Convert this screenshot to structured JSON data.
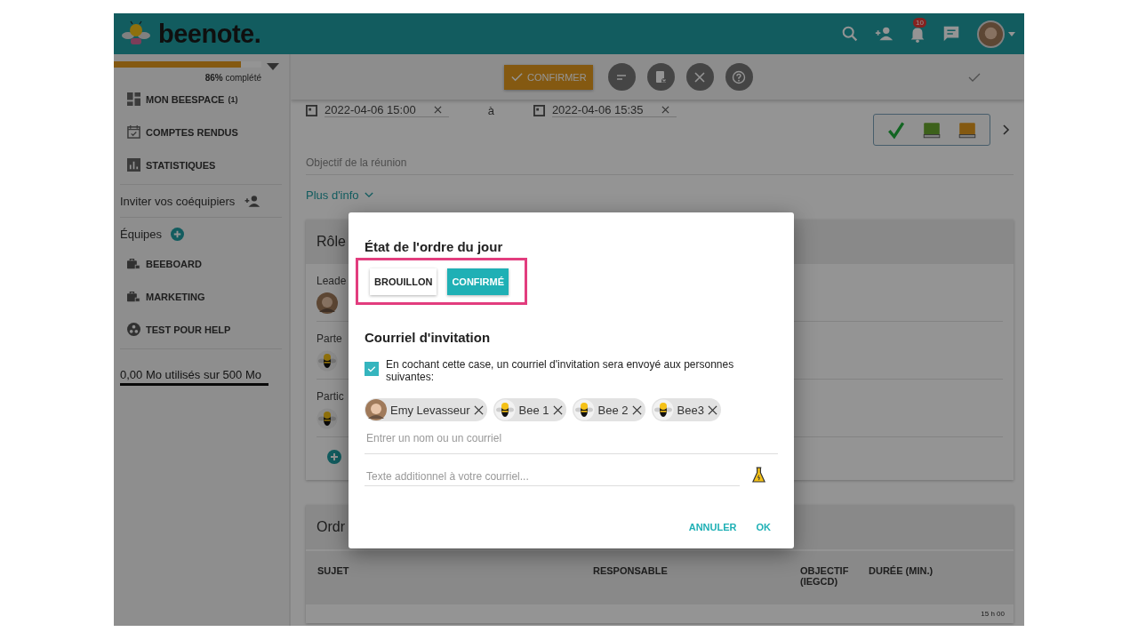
{
  "header": {
    "logo": "beenote.",
    "notification_count": "10"
  },
  "sidebar": {
    "progress": {
      "level": 0.86,
      "label": "**86%** complété"
    },
    "nav": [
      {
        "kind": "dashboard",
        "label": "MON BEESPACE",
        "count": "(1)"
      },
      {
        "kind": "calendar",
        "label": "COMPTES RENDUS"
      },
      {
        "kind": "chart",
        "label": "STATISTIQUES"
      }
    ],
    "invite": "Inviter vos coéquipiers",
    "teams_label": "Équipes",
    "teams": [
      {
        "kind": "locked",
        "label": "BEEBOARD"
      },
      {
        "kind": "locked",
        "label": "MARKETING"
      },
      {
        "kind": "group",
        "label": "TEST POUR HELP"
      }
    ],
    "storage": "0,00 Mo utilisés sur 500 Mo"
  },
  "toolbar": {
    "confirm": "CONFIRMER"
  },
  "meeting": {
    "start": "2022-04-06 15:00",
    "separator": "à",
    "end": "2022-04-06 15:35",
    "objective_placeholder": "Objectif de la réunion",
    "more_info": "Plus d'info",
    "roles": {
      "title": "Rôle",
      "rows": [
        {
          "label": "Leade",
          "kind": "photo"
        },
        {
          "label": "Parte",
          "kind": "bee"
        },
        {
          "label": "Partic",
          "kind": "bee"
        }
      ]
    },
    "agenda": {
      "title": "Ordr",
      "columns": [
        "SUJET",
        "RESPONSABLE",
        "OBJECTIF (IEGCD)",
        "DURÉE (MIN.)"
      ],
      "first_time": "15 h 00"
    }
  },
  "dialog": {
    "title": "État de l'ordre du jour",
    "states": [
      {
        "label": "BROUILLON",
        "selected": false
      },
      {
        "label": "CONFIRMÉ",
        "selected": true
      }
    ],
    "invite_title": "Courriel d'invitation",
    "send_invite": {
      "checked": true,
      "label": "En cochant cette case, un courriel d'invitation sera envoyé aux personnes suivantes:"
    },
    "recipients": [
      {
        "name": "Emy Levasseur",
        "kind": "photo"
      },
      {
        "name": "Bee 1",
        "kind": "bee"
      },
      {
        "name": "Bee 2",
        "kind": "bee"
      },
      {
        "name": "Bee3",
        "kind": "bee"
      }
    ],
    "recipient_placeholder": "Entrer un nom ou un courriel",
    "message_placeholder": "Texte additionnel à votre courriel...",
    "actions": [
      "ANNULER",
      "OK"
    ]
  }
}
